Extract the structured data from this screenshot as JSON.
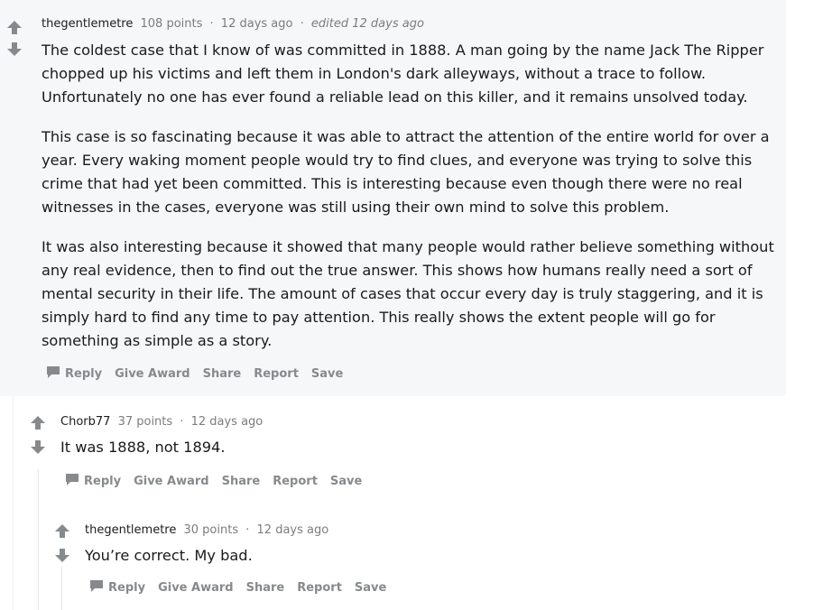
{
  "comments": [
    {
      "author": "thegentlemetre",
      "points": "108 points",
      "age": "12 days ago",
      "edited": "edited 12 days ago",
      "paragraphs": [
        "The coldest case that I know of was committed in 1888. A man going by the name Jack The Ripper chopped up his victims and left them in London's dark alleyways, without a trace to follow. Unfortunately no one has ever found a reliable lead on this killer, and it remains unsolved today.",
        "This case is so fascinating because it was able to attract the attention of the entire world for over a year. Every waking moment people would try to find clues, and everyone was trying to solve this crime that had yet been committed. This is interesting because even though there were no real witnesses in the cases, everyone was still using their own mind to solve this problem.",
        "It was also interesting because it showed that many people would rather believe something without any real evidence, then to find out the true answer. This shows how humans really need a sort of mental security in their life. The amount of cases that occur every day is truly staggering, and it is simply hard to find any time to pay attention. This really shows the extent people will go for something as simple as a story."
      ]
    },
    {
      "author": "Chorb77",
      "points": "37 points",
      "age": "12 days ago",
      "paragraphs": [
        "It was 1888, not 1894."
      ]
    },
    {
      "author": "thegentlemetre",
      "points": "30 points",
      "age": "12 days ago",
      "paragraphs": [
        "You’re correct. My bad."
      ]
    }
  ],
  "actions": {
    "reply": "Reply",
    "give_award": "Give Award",
    "share": "Share",
    "report": "Report",
    "save": "Save"
  },
  "colors": {
    "highlight_bg": "#f6f7f8",
    "arrow": "#878a8c",
    "meta_text": "#7c7c7c"
  },
  "icons": [
    "upvote-arrow-icon",
    "downvote-arrow-icon",
    "reply-bubble-icon"
  ]
}
